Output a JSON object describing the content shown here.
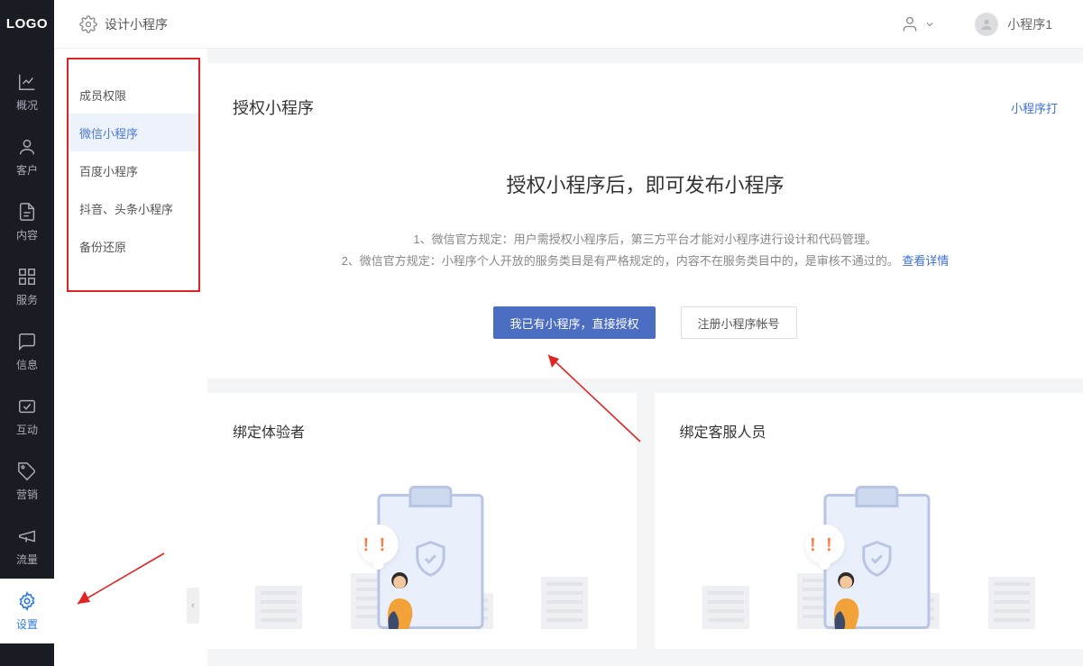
{
  "header": {
    "logo": "LOGO",
    "design_label": "设计小程序",
    "account_name": "小程序1"
  },
  "nav": {
    "items": [
      {
        "key": "overview",
        "label": "概况"
      },
      {
        "key": "customer",
        "label": "客户"
      },
      {
        "key": "content",
        "label": "内容"
      },
      {
        "key": "service",
        "label": "服务"
      },
      {
        "key": "message",
        "label": "信息"
      },
      {
        "key": "interact",
        "label": "互动"
      },
      {
        "key": "marketing",
        "label": "营销"
      },
      {
        "key": "traffic",
        "label": "流量"
      },
      {
        "key": "settings",
        "label": "设置"
      }
    ]
  },
  "settings_side": {
    "items": [
      {
        "key": "members",
        "label": "成员权限"
      },
      {
        "key": "wechat",
        "label": "微信小程序",
        "active": true
      },
      {
        "key": "baidu",
        "label": "百度小程序"
      },
      {
        "key": "douyin",
        "label": "抖音、头条小程序"
      },
      {
        "key": "backup",
        "label": "备份还原"
      }
    ]
  },
  "auth_card": {
    "title": "授权小程序",
    "corner_link": "小程序打",
    "headline": "授权小程序后，即可发布小程序",
    "line1": "1、微信官方规定：用户需授权小程序后，第三方平台才能对小程序进行设计和代码管理。",
    "line2_prefix": "2、微信官方规定：小程序个人开放的服务类目是有严格规定的，内容不在服务类目中的，是审核不通过的。",
    "line2_link": "查看详情",
    "btn_primary": "我已有小程序，直接授权",
    "btn_outline": "注册小程序帐号"
  },
  "lower": {
    "tester_title": "绑定体验者",
    "staff_title": "绑定客服人员",
    "bubble_text": "！！"
  }
}
